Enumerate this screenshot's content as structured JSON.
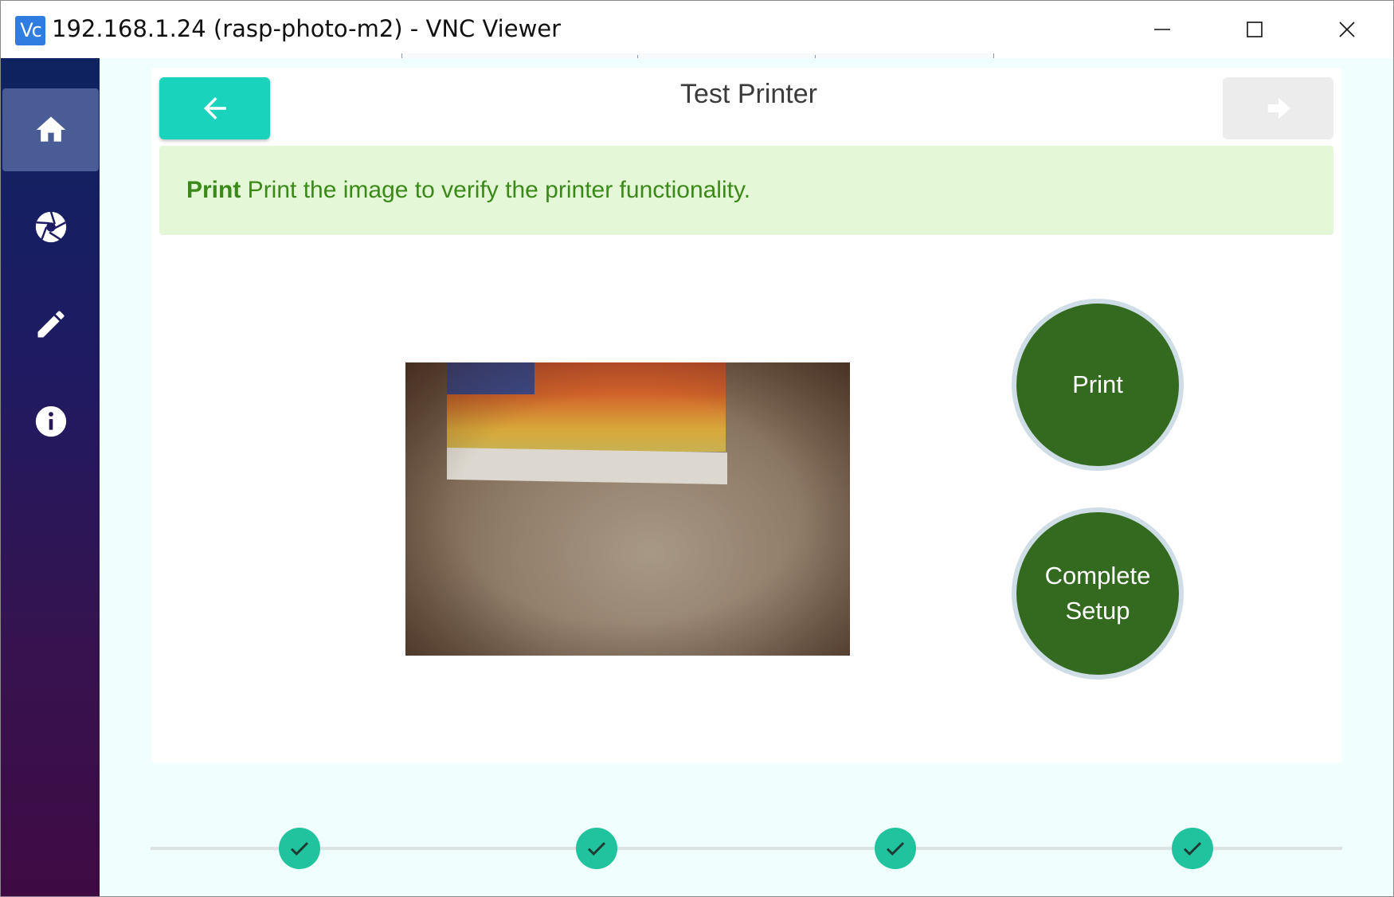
{
  "window": {
    "app_icon_text": "Vc",
    "title": "192.168.1.24 (rasp-photo-m2) - VNC Viewer"
  },
  "sidebar": {
    "items": [
      {
        "name": "home",
        "icon": "home-icon",
        "active": true
      },
      {
        "name": "camera",
        "icon": "camera-shutter-icon",
        "active": false
      },
      {
        "name": "edit",
        "icon": "pencil-icon",
        "active": false
      },
      {
        "name": "info",
        "icon": "info-icon",
        "active": false
      }
    ]
  },
  "header": {
    "title": "Test Printer",
    "back_icon": "arrow-left-icon",
    "next_icon": "arrow-right-icon"
  },
  "alert": {
    "strong": "Print",
    "message": " Print the image to verify the printer functionality."
  },
  "actions": {
    "print_label": "Print",
    "complete_line1": "Complete",
    "complete_line2": "Setup"
  },
  "stepper": {
    "steps": [
      {
        "status": "complete",
        "icon": "check-icon"
      },
      {
        "status": "complete",
        "icon": "check-icon"
      },
      {
        "status": "complete",
        "icon": "check-icon"
      },
      {
        "status": "complete",
        "icon": "check-icon"
      }
    ]
  },
  "colors": {
    "accent": "#1ad3bd",
    "action_green": "#346a20",
    "alert_bg": "#e4f7d6",
    "alert_text": "#3b8a19",
    "step_complete": "#21c29e"
  }
}
